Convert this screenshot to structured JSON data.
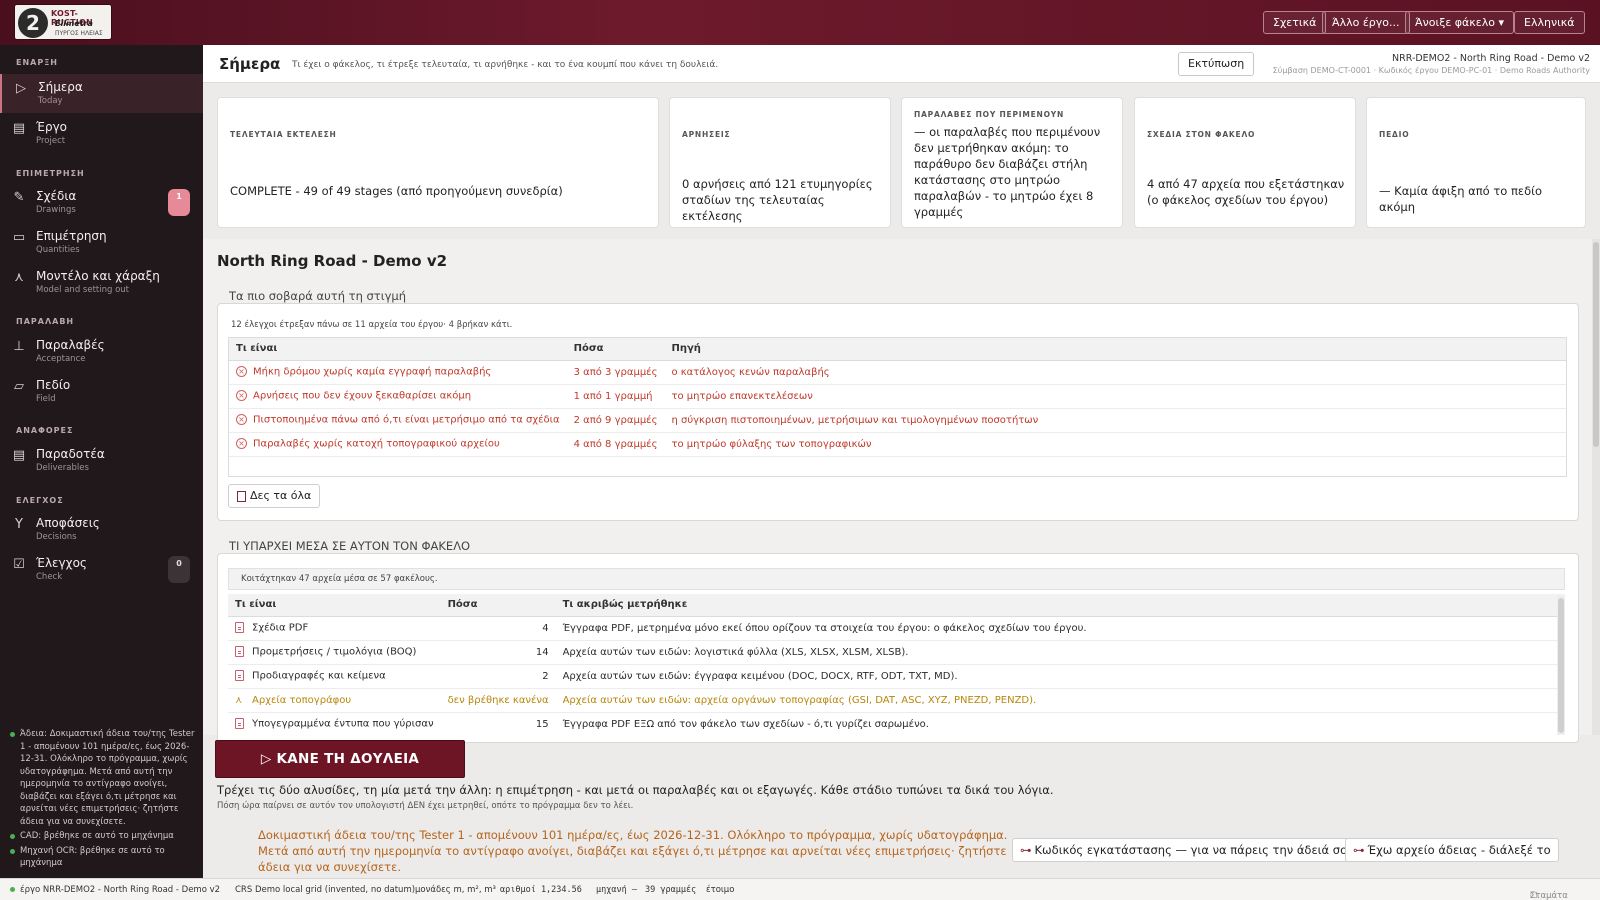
{
  "topbar": {
    "logo": {
      "line1": "KOST-RUCTION",
      "line2": "Ellmetra",
      "line3": "ΠΥΡΓΟΣ ΗΛΕΙΑΣ",
      "mark": "2"
    },
    "about": "Σχετικά",
    "other_project": "Άλλο έργο...",
    "open_folder": "Άνοιξε φάκελο ▾",
    "language": "Ελληνικά"
  },
  "sidebar": {
    "sections": [
      "ΕΝΑΡΞΗ",
      "ΕΠΙΜΕΤΡΗΣΗ",
      "ΠΑΡΑΛΑΒΗ",
      "ΑΝΑΦΟΡΕΣ",
      "ΕΛΕΓΧΟΣ"
    ],
    "items": [
      {
        "label": "Σήμερα",
        "sub": "Today",
        "icon": "play-icon"
      },
      {
        "label": "Έργο",
        "sub": "Project",
        "icon": "calendar-icon"
      },
      {
        "label": "Σχέδια",
        "sub": "Drawings",
        "icon": "edit-icon",
        "badge": "1"
      },
      {
        "label": "Επιμέτρηση",
        "sub": "Quantities",
        "icon": "ruler-icon"
      },
      {
        "label": "Μοντέλο και χάραξη",
        "sub": "Model and setting out",
        "icon": "survey-icon"
      },
      {
        "label": "Παραλαβές",
        "sub": "Acceptance",
        "icon": "stamp-icon"
      },
      {
        "label": "Πεδίο",
        "sub": "Field",
        "icon": "folder-icon"
      },
      {
        "label": "Παραδοτέα",
        "sub": "Deliverables",
        "icon": "document-icon"
      },
      {
        "label": "Αποφάσεις",
        "sub": "Decisions",
        "icon": "branch-icon"
      },
      {
        "label": "Έλεγχος",
        "sub": "Check",
        "icon": "checkbox-icon",
        "badge": "0"
      }
    ],
    "notes": [
      "Άδεια: Δοκιμαστική άδεια του/της Tester 1 - απομένουν 101 ημέρα/ες, έως 2026-12-31. Ολόκληρο το πρόγραμμα, χωρίς υδατογράφημα. Μετά από αυτή την ημερομηνία το αντίγραφο ανοίγει, διαβάζει και εξάγει ό,τι μέτρησε και αρνείται νέες επιμετρήσεις· ζητήστε άδεια για να συνεχίσετε.",
      "CAD: βρέθηκε σε αυτό το μηχάνημα",
      "Μηχανή OCR: βρέθηκε σε αυτό το μηχάνημα"
    ]
  },
  "header": {
    "title": "Σήμερα",
    "subtitle": "Τι έχει ο φάκελος, τι έτρεξε τελευταία, τι αρνήθηκε - και το ένα κουμπί που κάνει τη δουλειά.",
    "print": "Εκτύπωση",
    "project_line": "NRR-DEMO2 - North Ring Road - Demo v2",
    "contract_line": "Σύμβαση DEMO-CT-0001 · Κωδικός έργου DEMO-PC-01 · Demo Roads Authority"
  },
  "cards": [
    {
      "label": "ΤΕΛΕΥΤΑΙΑ ΕΚΤΕΛΕΣΗ",
      "value": "COMPLETE - 49 of 49 stages (από προηγούμενη συνεδρία)"
    },
    {
      "label": "ΑΡΝΗΣΕΙΣ",
      "value": "0 αρνήσεις από 121 ετυμηγορίες σταδίων της τελευταίας εκτέλεσης"
    },
    {
      "label": "ΠΑΡΑΛΑΒΕΣ ΠΟΥ ΠΕΡΙΜΕΝΟΥΝ",
      "value": "— οι παραλαβές που περιμένουν δεν μετρήθηκαν ακόμη: το παράθυρο δεν διαβάζει στήλη κατάστασης στο μητρώο παραλαβών - το μητρώο έχει 8 γραμμές"
    },
    {
      "label": "ΣΧΕΔΙΑ ΣΤΟΝ ΦΑΚΕΛΟ",
      "value": "4 από 47 αρχεία που εξετάστηκαν (ο φάκελος σχεδίων του έργου)"
    },
    {
      "label": "ΠΕΔΙΟ",
      "value": "— Καμία άφιξη από το πεδίο ακόμη"
    }
  ],
  "project_title": "North Ring Road - Demo v2",
  "serious": {
    "legend": "Τα πιο σοβαρά αυτή τη στιγμή",
    "note": "12 έλεγχοι έτρεξαν πάνω σε 11 αρχεία του έργου· 4 βρήκαν κάτι.",
    "columns": [
      "Τι είναι",
      "Πόσα",
      "Πηγή"
    ],
    "rows": [
      {
        "what": "Μήκη δρόμου χωρίς καμία εγγραφή παραλαβής",
        "count": "3 από 3 γραμμές",
        "source": "ο κατάλογος κενών παραλαβής"
      },
      {
        "what": "Αρνήσεις που δεν έχουν ξεκαθαρίσει ακόμη",
        "count": "1 από 1 γραμμή",
        "source": "το μητρώο επανεκτελέσεων"
      },
      {
        "what": "Πιστοποιημένα πάνω από ό,τι είναι μετρήσιμο από τα σχέδια",
        "count": "2 από 9 γραμμές",
        "source": "η σύγκριση πιστοποιημένων, μετρήσιμων και τιμολογημένων ποσοτήτων"
      },
      {
        "what": "Παραλαβές χωρίς κατοχή τοπογραφικού αρχείου",
        "count": "4 από 8 γραμμές",
        "source": "το μητρώο φύλαξης των τοπογραφικών"
      }
    ],
    "see_all": "Δες τα όλα"
  },
  "folder": {
    "legend": "ΤΙ ΥΠΑΡΧΕΙ ΜΕΣΑ ΣΕ ΑΥΤΟΝ ΤΟΝ ΦΑΚΕΛΟ",
    "note": "Κοιτάχτηκαν 47 αρχεία μέσα σε 57 φακέλους.",
    "columns": [
      "Τι είναι",
      "Πόσα",
      "Τι ακριβώς μετρήθηκε"
    ],
    "rows": [
      {
        "what": "Σχέδια PDF",
        "count": "4",
        "detail": "Έγγραφα PDF, μετρημένα μόνο εκεί όπου ορίζουν τα στοιχεία του έργου: ο φάκελος σχεδίων του έργου.",
        "kind": "file"
      },
      {
        "what": "Προμετρήσεις / τιμολόγια (BOQ)",
        "count": "14",
        "detail": "Αρχεία αυτών των ειδών: λογιστικά φύλλα (XLS, XLSX, XLSM, XLSB).",
        "kind": "file"
      },
      {
        "what": "Προδιαγραφές και κείμενα",
        "count": "2",
        "detail": "Αρχεία αυτών των ειδών: έγγραφα κειμένου (DOC, DOCX, RTF, ODT, TXT, MD).",
        "kind": "file"
      },
      {
        "what": "Αρχεία τοπογράφου",
        "count": "δεν βρέθηκε κανένα",
        "detail": "Αρχεία αυτών των ειδών: αρχεία οργάνων τοπογραφίας (GSI, DAT, ASC, XYZ, PNEZD, PENZD).",
        "kind": "survey"
      },
      {
        "what": "Υπογεγραμμένα έντυπα που γύρισαν",
        "count": "15",
        "detail": "Έγγραφα PDF ΕΞΩ από τον φάκελο των σχεδίων - ό,τι γυρίζει σαρωμένο.",
        "kind": "file"
      }
    ]
  },
  "action": {
    "button": "▷ ΚΑΝΕ ΤΗ ΔΟΥΛΕΙΑ",
    "desc": "Τρέχει τις δύο αλυσίδες, τη μία μετά την άλλη: η επιμέτρηση - και μετά οι παραλαβές και οι εξαγωγές. Κάθε στάδιο τυπώνει τα δικά του λόγια.",
    "sub": "Πόση ώρα παίρνει σε αυτόν τον υπολογιστή ΔΕΝ έχει μετρηθεί, οπότε το πρόγραμμα δεν το λέει."
  },
  "license": {
    "text": "Δοκιμαστική άδεια του/της Tester 1 - απομένουν 101 ημέρα/ες, έως 2026-12-31. Ολόκληρο το πρόγραμμα, χωρίς υδατογράφημα. Μετά από αυτή την ημερομηνία το αντίγραφο ανοίγει, διαβάζει και εξάγει ό,τι μέτρησε και αρνείται νέες επιμετρήσεις· ζητήστε άδεια για να συνεχίσετε.",
    "install_code": "Κωδικός εγκατάστασης — για να πάρεις την άδειά σου",
    "have_file": "Έχω αρχείο άδειας - διάλεξέ το"
  },
  "status": {
    "project": "έργο NRR-DEMO2 - North Ring Road - Demo v2",
    "crs": "CRS Demo local grid (invented, no datum)",
    "units": "μονάδες m, m², m³",
    "numbers": "αριθμοί 1,234.56",
    "machine": "μηχανή –",
    "lines": "39 γραμμές",
    "ready": "έτοιμο",
    "stop": "Σταμάτα"
  },
  "colors": {
    "brand": "#6d1a2c",
    "alert": "#c0392b",
    "warning": "#b8860b",
    "ok": "#4caf50"
  }
}
